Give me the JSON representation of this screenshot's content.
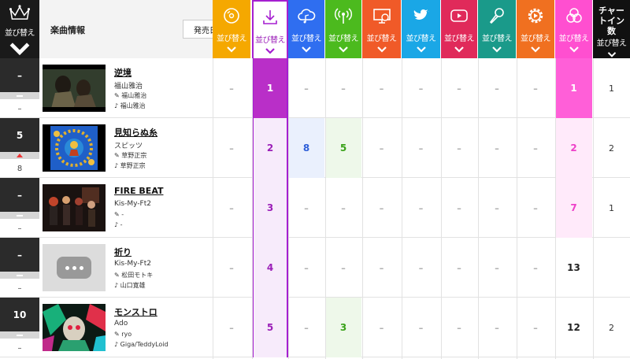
{
  "header": {
    "sort_label": "並び替え",
    "info_title": "楽曲情報",
    "sort_select": "発売日",
    "chart_in_count": "チャートイン数",
    "columns": [
      {
        "name": "cd",
        "color": "#f5a800",
        "icon": "cd-icon"
      },
      {
        "name": "download",
        "color": "#a51fd0",
        "icon": "download-icon"
      },
      {
        "name": "streaming",
        "color": "#2f6ef0",
        "icon": "cloud-music-icon"
      },
      {
        "name": "radio",
        "color": "#4cba1e",
        "icon": "radio-icon"
      },
      {
        "name": "pc-lookup",
        "color": "#f05a28",
        "icon": "pc-disc-icon"
      },
      {
        "name": "twitter",
        "color": "#1aa7e6",
        "icon": "twitter-icon"
      },
      {
        "name": "youtube",
        "color": "#e02a5a",
        "icon": "youtube-icon"
      },
      {
        "name": "karaoke",
        "color": "#1a9a8a",
        "icon": "microphone-icon"
      },
      {
        "name": "gyao",
        "color": "#f07020",
        "icon": "play-gear-icon"
      },
      {
        "name": "total",
        "color": "#ff4fd0",
        "icon": "circles-icon"
      }
    ]
  },
  "rows": [
    {
      "rank": "–",
      "mid": "dash",
      "prev": "–",
      "title": "逆境",
      "artist": "福山雅治",
      "lyric": "福山雅治",
      "music": "福山雅治",
      "cells": [
        "–",
        "1",
        "–",
        "–",
        "–",
        "–",
        "–",
        "–",
        "–",
        "1",
        "1"
      ]
    },
    {
      "rank": "5",
      "mid": "up",
      "prev": "8",
      "title": "見知らぬ糸",
      "artist": "スピッツ",
      "lyric": "草野正宗",
      "music": "草野正宗",
      "cells": [
        "–",
        "2",
        "8",
        "5",
        "–",
        "–",
        "–",
        "–",
        "–",
        "2",
        "2"
      ]
    },
    {
      "rank": "–",
      "mid": "dash",
      "prev": "–",
      "title": "FIRE BEAT",
      "artist": "Kis-My-Ft2",
      "lyric": "-",
      "music": "-",
      "cells": [
        "–",
        "3",
        "–",
        "–",
        "–",
        "–",
        "–",
        "–",
        "–",
        "7",
        "1"
      ]
    },
    {
      "rank": "–",
      "mid": "dash",
      "prev": "–",
      "title": "祈り",
      "artist": "Kis-My-Ft2",
      "lyric": "松田モトキ",
      "music": "山口寛雄",
      "cells": [
        "–",
        "4",
        "–",
        "–",
        "–",
        "–",
        "–",
        "–",
        "–",
        "13",
        ""
      ]
    },
    {
      "rank": "10",
      "mid": "dash",
      "prev": "–",
      "title": "モンストロ",
      "artist": "Ado",
      "lyric": "ryo",
      "music": "Giga/TeddyLoid",
      "cells": [
        "–",
        "5",
        "–",
        "3",
        "–",
        "–",
        "–",
        "–",
        "–",
        "12",
        "2"
      ]
    }
  ]
}
